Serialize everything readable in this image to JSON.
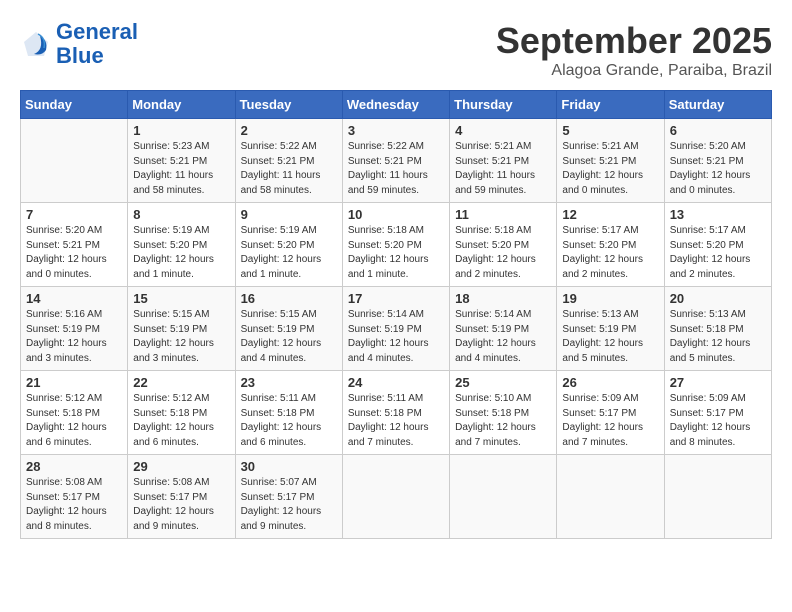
{
  "logo": {
    "line1": "General",
    "line2": "Blue"
  },
  "title": "September 2025",
  "location": "Alagoa Grande, Paraiba, Brazil",
  "days_header": [
    "Sunday",
    "Monday",
    "Tuesday",
    "Wednesday",
    "Thursday",
    "Friday",
    "Saturday"
  ],
  "weeks": [
    [
      {
        "day": "",
        "info": ""
      },
      {
        "day": "1",
        "info": "Sunrise: 5:23 AM\nSunset: 5:21 PM\nDaylight: 11 hours\nand 58 minutes."
      },
      {
        "day": "2",
        "info": "Sunrise: 5:22 AM\nSunset: 5:21 PM\nDaylight: 11 hours\nand 58 minutes."
      },
      {
        "day": "3",
        "info": "Sunrise: 5:22 AM\nSunset: 5:21 PM\nDaylight: 11 hours\nand 59 minutes."
      },
      {
        "day": "4",
        "info": "Sunrise: 5:21 AM\nSunset: 5:21 PM\nDaylight: 11 hours\nand 59 minutes."
      },
      {
        "day": "5",
        "info": "Sunrise: 5:21 AM\nSunset: 5:21 PM\nDaylight: 12 hours\nand 0 minutes."
      },
      {
        "day": "6",
        "info": "Sunrise: 5:20 AM\nSunset: 5:21 PM\nDaylight: 12 hours\nand 0 minutes."
      }
    ],
    [
      {
        "day": "7",
        "info": "Sunrise: 5:20 AM\nSunset: 5:21 PM\nDaylight: 12 hours\nand 0 minutes."
      },
      {
        "day": "8",
        "info": "Sunrise: 5:19 AM\nSunset: 5:20 PM\nDaylight: 12 hours\nand 1 minute."
      },
      {
        "day": "9",
        "info": "Sunrise: 5:19 AM\nSunset: 5:20 PM\nDaylight: 12 hours\nand 1 minute."
      },
      {
        "day": "10",
        "info": "Sunrise: 5:18 AM\nSunset: 5:20 PM\nDaylight: 12 hours\nand 1 minute."
      },
      {
        "day": "11",
        "info": "Sunrise: 5:18 AM\nSunset: 5:20 PM\nDaylight: 12 hours\nand 2 minutes."
      },
      {
        "day": "12",
        "info": "Sunrise: 5:17 AM\nSunset: 5:20 PM\nDaylight: 12 hours\nand 2 minutes."
      },
      {
        "day": "13",
        "info": "Sunrise: 5:17 AM\nSunset: 5:20 PM\nDaylight: 12 hours\nand 2 minutes."
      }
    ],
    [
      {
        "day": "14",
        "info": "Sunrise: 5:16 AM\nSunset: 5:19 PM\nDaylight: 12 hours\nand 3 minutes."
      },
      {
        "day": "15",
        "info": "Sunrise: 5:15 AM\nSunset: 5:19 PM\nDaylight: 12 hours\nand 3 minutes."
      },
      {
        "day": "16",
        "info": "Sunrise: 5:15 AM\nSunset: 5:19 PM\nDaylight: 12 hours\nand 4 minutes."
      },
      {
        "day": "17",
        "info": "Sunrise: 5:14 AM\nSunset: 5:19 PM\nDaylight: 12 hours\nand 4 minutes."
      },
      {
        "day": "18",
        "info": "Sunrise: 5:14 AM\nSunset: 5:19 PM\nDaylight: 12 hours\nand 4 minutes."
      },
      {
        "day": "19",
        "info": "Sunrise: 5:13 AM\nSunset: 5:19 PM\nDaylight: 12 hours\nand 5 minutes."
      },
      {
        "day": "20",
        "info": "Sunrise: 5:13 AM\nSunset: 5:18 PM\nDaylight: 12 hours\nand 5 minutes."
      }
    ],
    [
      {
        "day": "21",
        "info": "Sunrise: 5:12 AM\nSunset: 5:18 PM\nDaylight: 12 hours\nand 6 minutes."
      },
      {
        "day": "22",
        "info": "Sunrise: 5:12 AM\nSunset: 5:18 PM\nDaylight: 12 hours\nand 6 minutes."
      },
      {
        "day": "23",
        "info": "Sunrise: 5:11 AM\nSunset: 5:18 PM\nDaylight: 12 hours\nand 6 minutes."
      },
      {
        "day": "24",
        "info": "Sunrise: 5:11 AM\nSunset: 5:18 PM\nDaylight: 12 hours\nand 7 minutes."
      },
      {
        "day": "25",
        "info": "Sunrise: 5:10 AM\nSunset: 5:18 PM\nDaylight: 12 hours\nand 7 minutes."
      },
      {
        "day": "26",
        "info": "Sunrise: 5:09 AM\nSunset: 5:17 PM\nDaylight: 12 hours\nand 7 minutes."
      },
      {
        "day": "27",
        "info": "Sunrise: 5:09 AM\nSunset: 5:17 PM\nDaylight: 12 hours\nand 8 minutes."
      }
    ],
    [
      {
        "day": "28",
        "info": "Sunrise: 5:08 AM\nSunset: 5:17 PM\nDaylight: 12 hours\nand 8 minutes."
      },
      {
        "day": "29",
        "info": "Sunrise: 5:08 AM\nSunset: 5:17 PM\nDaylight: 12 hours\nand 9 minutes."
      },
      {
        "day": "30",
        "info": "Sunrise: 5:07 AM\nSunset: 5:17 PM\nDaylight: 12 hours\nand 9 minutes."
      },
      {
        "day": "",
        "info": ""
      },
      {
        "day": "",
        "info": ""
      },
      {
        "day": "",
        "info": ""
      },
      {
        "day": "",
        "info": ""
      }
    ]
  ]
}
